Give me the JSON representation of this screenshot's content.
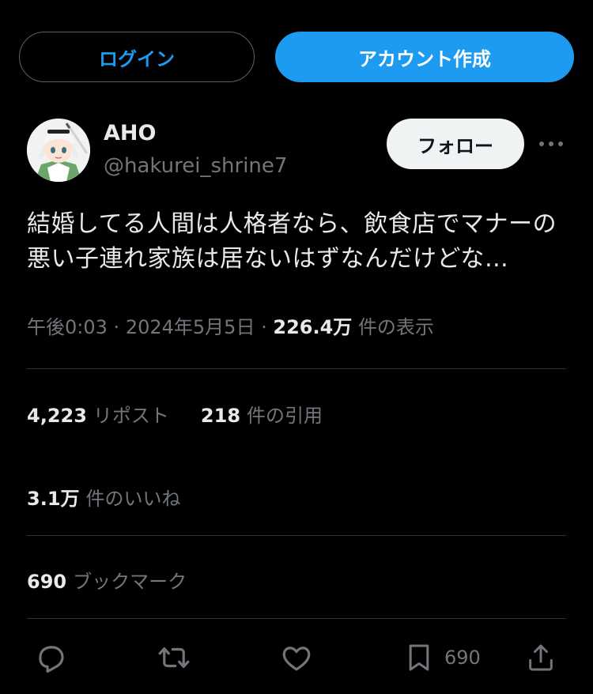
{
  "auth": {
    "login_label": "ログイン",
    "signup_label": "アカウント作成"
  },
  "author": {
    "display_name": "AHO",
    "handle": "@hakurei_shrine7",
    "follow_label": "フォロー"
  },
  "tweet": {
    "text": "結婚してる人間は人格者なら、飲食店でマナーの悪い子連れ家族は居ないはずなんだけどな…",
    "time": "午後0:03",
    "separator": "·",
    "date": "2024年5月5日",
    "views_count": "226.4万",
    "views_label": "件の表示"
  },
  "stats": {
    "reposts_count": "4,223",
    "reposts_label": "リポスト",
    "quotes_count": "218",
    "quotes_label": "件の引用",
    "likes_count": "3.1万",
    "likes_label": "件のいいね",
    "bookmarks_count": "690",
    "bookmarks_label": "ブックマーク"
  },
  "actions": {
    "bookmark_count": "690"
  },
  "icons": {
    "more": "more-icon",
    "reply": "reply-icon",
    "repost": "repost-icon",
    "like": "heart-icon",
    "bookmark": "bookmark-icon",
    "share": "share-icon"
  },
  "colors": {
    "background": "#000000",
    "accent": "#1d9bf0",
    "text_primary": "#e7e9ea",
    "text_secondary": "#71767b",
    "divider": "#2f3336",
    "follow_bg": "#eff3f4"
  }
}
